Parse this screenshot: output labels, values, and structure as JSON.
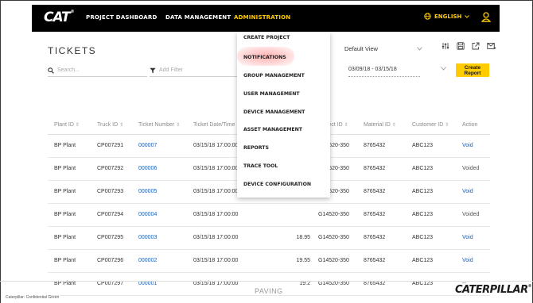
{
  "nav": {
    "logo": "CAT",
    "items": [
      {
        "label": "PROJECT DASHBOARD"
      },
      {
        "label": "DATA MANAGEMENT"
      },
      {
        "label": "ADMINISTRATION"
      }
    ],
    "language": "ENGLISH",
    "accent_color": "#ffcc00"
  },
  "page": {
    "title": "TICKETS"
  },
  "toolbar": {
    "search_placeholder": "Search...",
    "filter_placeholder": "Add Filter",
    "view_label": "Default View",
    "date_range": "03/09/18 - 03/15/18",
    "create_report_label": "Create Report",
    "icons": [
      "sliders-icon",
      "save-icon",
      "external-link-icon",
      "email-icon"
    ]
  },
  "dropdown": {
    "items": [
      "CREATE PROJECT",
      "NOTIFICATIONS",
      "GROUP MANAGEMENT",
      "USER MANAGEMENT",
      "DEVICE MANAGEMENT",
      "ASSET MANAGEMENT",
      "REPORTS",
      "TRACE TOOL",
      "DEVICE CONFIGURATION"
    ],
    "highlighted_item": "NOTIFICATIONS"
  },
  "table": {
    "columns": [
      "Plant ID",
      "Truck ID",
      "Ticket Number",
      "Ticket Date/Time",
      "",
      "Project ID",
      "Material ID",
      "Customer ID",
      "Action"
    ],
    "rows": [
      {
        "plant": "BP Plant",
        "truck": "CP007291",
        "ticket": "000007",
        "datetime": "03/15/18 17:00:00",
        "qty": "",
        "project": "G14520-350",
        "material": "8765432",
        "customer": "ABC123",
        "action": "Void"
      },
      {
        "plant": "BP Plant",
        "truck": "CP007292",
        "ticket": "000006",
        "datetime": "03/15/18 17:00:00",
        "qty": "",
        "project": "G14520-350",
        "material": "8765432",
        "customer": "ABC123",
        "action": "Voided"
      },
      {
        "plant": "BP Plant",
        "truck": "CP007293",
        "ticket": "000005",
        "datetime": "03/15/18 17:00:00",
        "qty": "",
        "project": "G14520-350",
        "material": "8765432",
        "customer": "ABC123",
        "action": "Void"
      },
      {
        "plant": "BP Plant",
        "truck": "CP007294",
        "ticket": "000004",
        "datetime": "03/15/18 17:00:00",
        "qty": "",
        "project": "G14520-350",
        "material": "8765432",
        "customer": "ABC123",
        "action": "Voided"
      },
      {
        "plant": "BP Plant",
        "truck": "CP007295",
        "ticket": "000003",
        "datetime": "03/15/18 17:00:00",
        "qty": "18.95",
        "project": "G14520-350",
        "material": "8765432",
        "customer": "ABC123",
        "action": "Void"
      },
      {
        "plant": "BP Plant",
        "truck": "CP007296",
        "ticket": "000002",
        "datetime": "03/15/18 17:00:00",
        "qty": "19.55",
        "project": "G14520-350",
        "material": "8765432",
        "customer": "ABC123",
        "action": "Void"
      },
      {
        "plant": "BP Plant",
        "truck": "CP007297",
        "ticket": "000001",
        "datetime": "03/15/18 17:00:00",
        "qty": "19.2",
        "project": "G14520-350",
        "material": "8765432",
        "customer": "ABC123",
        "action": "--"
      }
    ]
  },
  "footer": {
    "center_label": "PAVING",
    "brand": "CATERPILLAR",
    "left_note": "Caterpillar: Confidential Green"
  }
}
